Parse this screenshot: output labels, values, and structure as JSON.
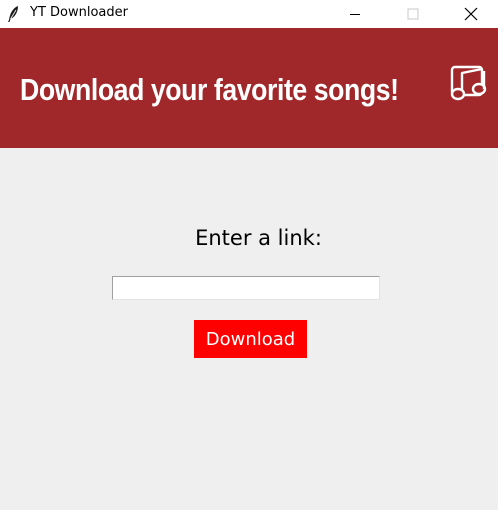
{
  "window": {
    "title": "YT Downloader"
  },
  "banner": {
    "heading": "Download your favorite songs!",
    "icon": "music-notes-icon",
    "color": "#a0282a"
  },
  "form": {
    "prompt": "Enter a link:",
    "link_value": "",
    "link_placeholder": "",
    "download_label": "Download",
    "button_color": "#ff0000"
  }
}
